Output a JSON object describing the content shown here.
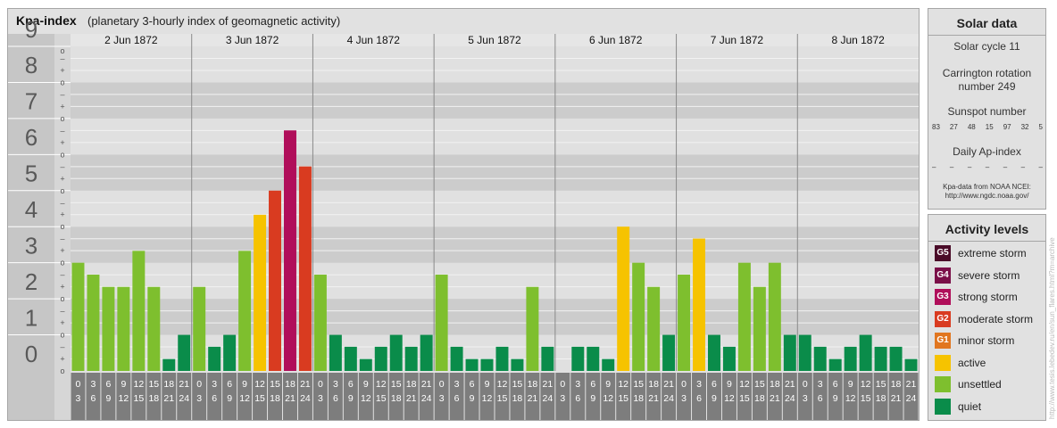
{
  "header": {
    "title": "Kpa-index",
    "subtitle": "(planetary 3-hourly index of geomagnetic activity)"
  },
  "chart_data": {
    "type": "bar",
    "title": "Kpa-index",
    "subtitle": "(planetary 3-hourly index of geomagnetic activity)",
    "y_ticks": [
      "0",
      "1",
      "2",
      "3",
      "4",
      "5",
      "6",
      "7",
      "8",
      "9"
    ],
    "ylim": [
      0,
      9
    ],
    "minor_tick_marks": [
      "o",
      "+",
      "–"
    ],
    "days": [
      "2 Jun 1872",
      "3 Jun 1872",
      "4 Jun 1872",
      "5 Jun 1872",
      "6 Jun 1872",
      "7 Jun 1872",
      "8 Jun 1872"
    ],
    "interval_starts": [
      "0",
      "3",
      "6",
      "9",
      "12",
      "15",
      "18",
      "21"
    ],
    "interval_ends": [
      "3",
      "6",
      "9",
      "12",
      "15",
      "18",
      "21",
      "24"
    ],
    "values": [
      [
        3,
        2.67,
        2.33,
        2.33,
        3.33,
        2.33,
        0.33,
        1
      ],
      [
        2.33,
        0.67,
        1,
        3.33,
        4.33,
        5,
        6.67,
        5.67
      ],
      [
        2.67,
        1,
        0.67,
        0.33,
        0.67,
        1,
        0.67,
        1
      ],
      [
        2.67,
        0.67,
        0.33,
        0.33,
        0.67,
        0.33,
        2.33,
        0.67
      ],
      [
        0,
        0.67,
        0.67,
        0.33,
        4,
        3,
        2.33,
        1
      ],
      [
        2.67,
        3.67,
        1,
        0.67,
        3,
        2.33,
        3,
        1
      ],
      [
        1,
        0.67,
        0.33,
        0.67,
        1,
        0.67,
        0.67,
        0.33
      ]
    ],
    "grid": true,
    "legend": "right"
  },
  "solar": {
    "title": "Solar data",
    "cycle": "Solar cycle 11",
    "carrington_1": "Carrington rotation",
    "carrington_2": "number 249",
    "sunspot_title": "Sunspot number",
    "sunspots": [
      "83",
      "27",
      "48",
      "15",
      "97",
      "32",
      "5"
    ],
    "ap_title": "Daily Ap-index",
    "ap_values": [
      "–",
      "–",
      "–",
      "–",
      "–",
      "–",
      "–"
    ],
    "source_1": "Kpa-data from NOAA NCEI:",
    "source_2": "http://www.ngdc.noaa.gov/"
  },
  "activity": {
    "title": "Activity levels",
    "levels": [
      {
        "badge": "G5",
        "label": "extreme storm",
        "color": "#4a0b28"
      },
      {
        "badge": "G4",
        "label": "severe storm",
        "color": "#7a0f48"
      },
      {
        "badge": "G3",
        "label": "strong storm",
        "color": "#b00e5a"
      },
      {
        "badge": "G2",
        "label": "moderate storm",
        "color": "#d93b20"
      },
      {
        "badge": "G1",
        "label": "minor storm",
        "color": "#e1761f"
      },
      {
        "badge": "",
        "label": "active",
        "color": "#f6c300"
      },
      {
        "badge": "",
        "label": "unsettled",
        "color": "#7ebf2e"
      },
      {
        "badge": "",
        "label": "quiet",
        "color": "#0a8c4a"
      }
    ]
  },
  "watermark": "http://www.tesis.lebedev.ru/en/sun_flares.html?m=archive"
}
